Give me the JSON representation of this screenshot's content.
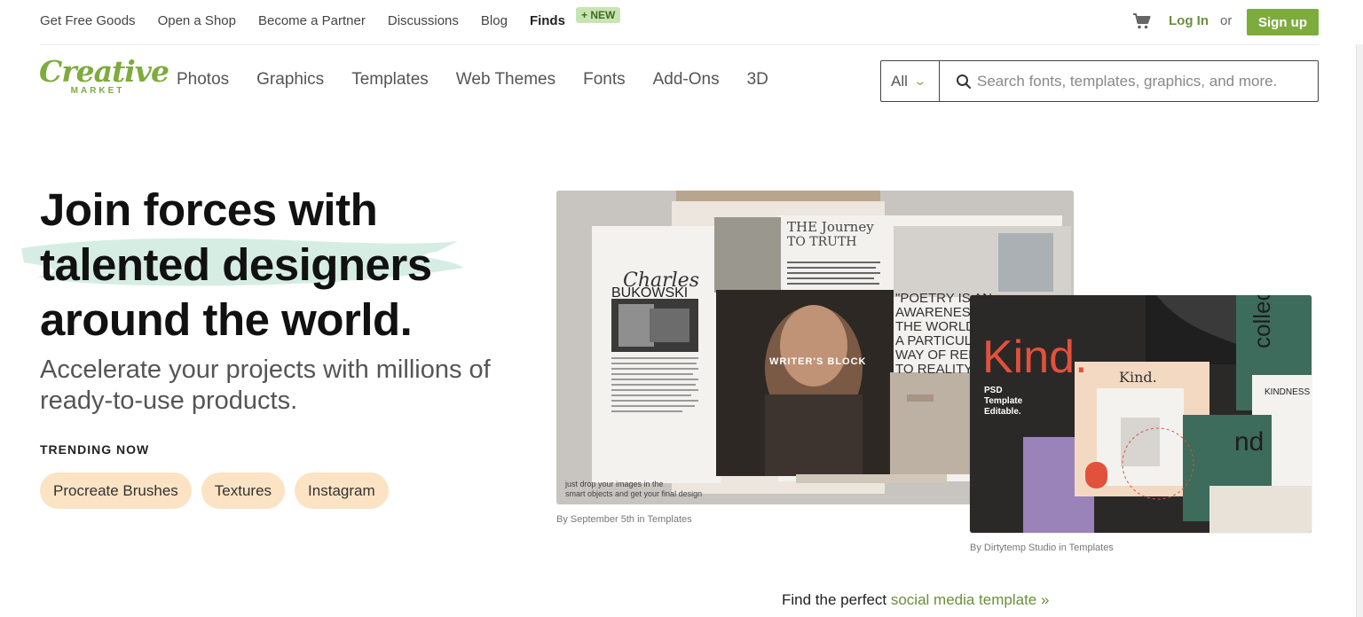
{
  "topnav": {
    "items": [
      "Get Free Goods",
      "Open a Shop",
      "Become a Partner",
      "Discussions",
      "Blog",
      "Finds"
    ],
    "new_badge": "+ NEW",
    "login": "Log In",
    "or": "or",
    "signup": "Sign up"
  },
  "logo": {
    "word": "Creative",
    "sub": "MARKET"
  },
  "mainnav": {
    "items": [
      "Photos",
      "Graphics",
      "Templates",
      "Web Themes",
      "Fonts",
      "Add-Ons",
      "3D"
    ]
  },
  "search": {
    "category": "All",
    "placeholder": "Search fonts, templates, graphics, and more."
  },
  "hero": {
    "headline": [
      "Join forces with",
      "talented designers",
      "around the world."
    ],
    "subhead": "Accelerate your projects with millions of ready-to-use products.",
    "trending_label": "TRENDING NOW",
    "chips": [
      "Procreate Brushes",
      "Textures",
      "Instagram"
    ]
  },
  "preview_a": {
    "caption": "By September 5th in Templates",
    "texts": {
      "name1": "Charles",
      "name2": "BUKOWSKI",
      "journey1": "THE Journey",
      "journey2": "TO TRUTH",
      "quote": "\"POETRY IS AN AWARENESS OF THE WORLD, A PARTICULAR WAY OF RELATING TO REALITY",
      "writers": "WRITER'S BLOCK",
      "footer": "just drop your images in the smart objects and get your final design"
    }
  },
  "preview_b": {
    "caption": "By Dirtytemp Studio in Templates",
    "texts": {
      "kind": "Kind.",
      "psd": "PSD Template Editable.",
      "kind_small": "Kind.",
      "kindness": "KINDNESS",
      "collection": "collection"
    }
  },
  "footer_cta": {
    "prefix": "Find the perfect ",
    "link": "social media template »"
  },
  "colors": {
    "brand_green": "#7eab3e",
    "chip_bg": "#fbe3c4",
    "kind_red": "#e2513c"
  }
}
